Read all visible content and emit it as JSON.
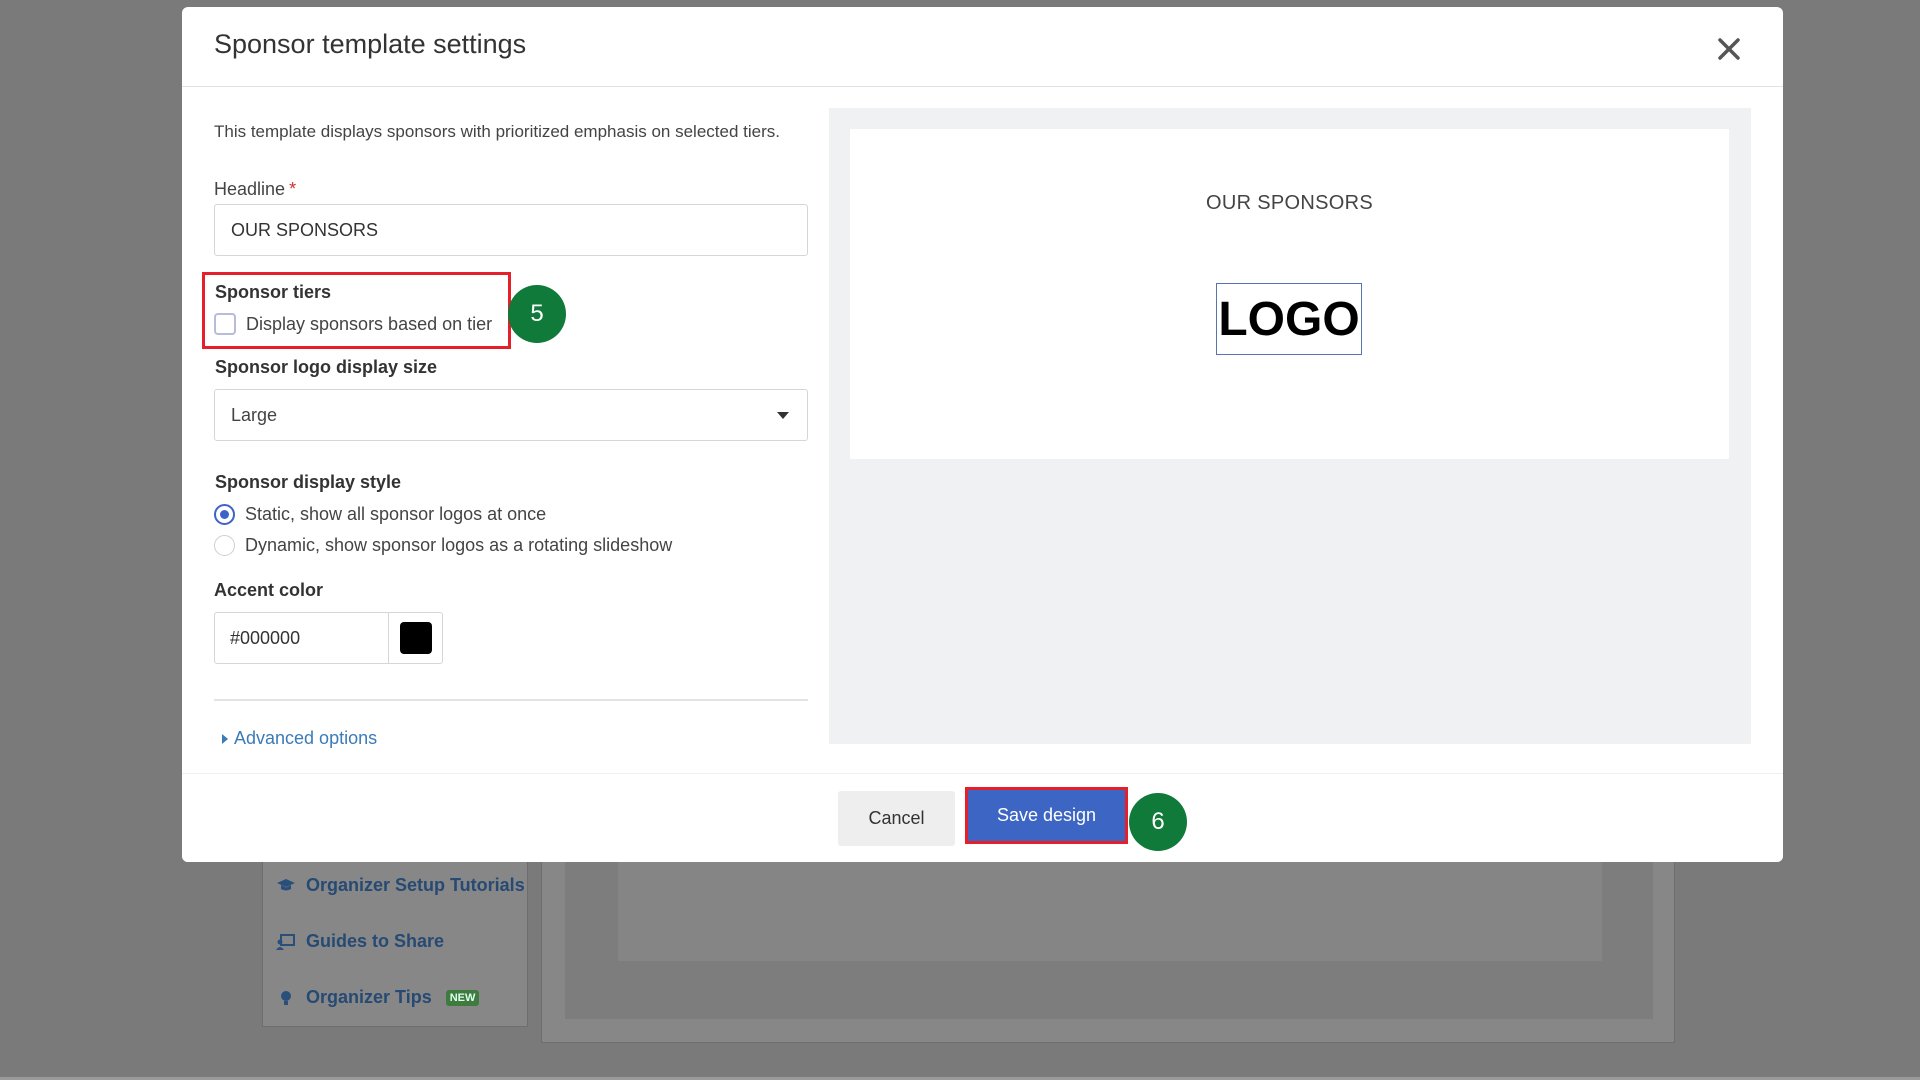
{
  "background": {
    "nav_items": [
      {
        "label": "Organizer Setup Tutorials",
        "icon": "graduation-cap-icon"
      },
      {
        "label": "Guides to Share",
        "icon": "presentation-icon"
      },
      {
        "label": "Organizer Tips",
        "icon": "lightbulb-icon",
        "badge": "NEW"
      }
    ]
  },
  "modal": {
    "title": "Sponsor template settings",
    "description": "This template displays sponsors with prioritized emphasis on selected tiers.",
    "headline": {
      "label": "Headline",
      "required_mark": "*",
      "value": "OUR SPONSORS"
    },
    "sponsor_tiers": {
      "label": "Sponsor tiers",
      "checkbox_label": "Display sponsors based on tier",
      "checked": false
    },
    "logo_size": {
      "label": "Sponsor logo display size",
      "value": "Large"
    },
    "display_style": {
      "label": "Sponsor display style",
      "options": [
        {
          "label": "Static, show all sponsor logos at once",
          "selected": true
        },
        {
          "label": "Dynamic, show sponsor logos as a rotating slideshow",
          "selected": false
        }
      ]
    },
    "accent_color": {
      "label": "Accent color",
      "value": "#000000",
      "swatch": "#000000"
    },
    "advanced_options": "Advanced options",
    "preview": {
      "headline": "OUR SPONSORS",
      "logo_text": "LOGO"
    },
    "footer": {
      "cancel_label": "Cancel",
      "save_label": "Save design"
    }
  },
  "annotations": {
    "step_5": "5",
    "step_6": "6"
  },
  "colors": {
    "accent_blue": "#3d66c4",
    "highlight_red": "#e5202a",
    "step_badge_green": "#0f7a3a"
  }
}
